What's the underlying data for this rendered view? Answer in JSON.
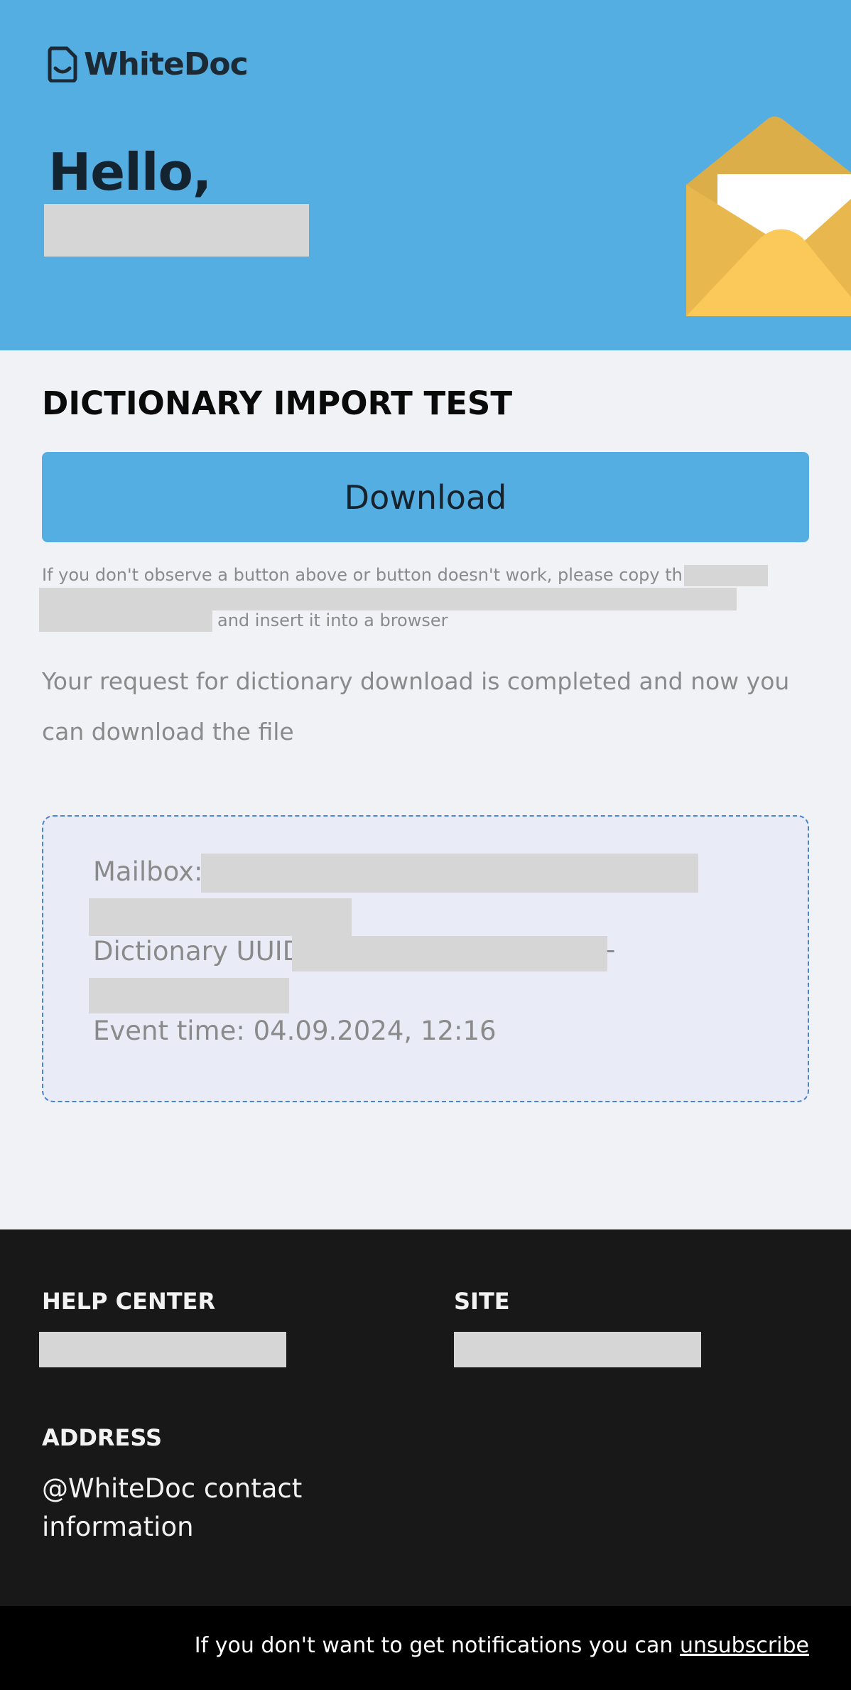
{
  "brand": {
    "name": "WhiteDoc"
  },
  "header": {
    "greeting": "Hello,"
  },
  "main": {
    "title": "DICTIONARY IMPORT TEST",
    "download_label": "Download",
    "hint_prefix": "If you don't observe a button above or button doesn't work, please copy this link",
    "hint_suffix": "and insert it into a browser",
    "description": "Your request for dictionary download is completed and now you can download the file"
  },
  "info": {
    "mailbox_label": "Mailbox:",
    "uuid_label": "Dictionary UUID:",
    "uuid_dash": "-",
    "event_time": "Event time: 04.09.2024, 12:16"
  },
  "footer": {
    "help_center": "HELP CENTER",
    "site": "SITE",
    "address": "ADDRESS",
    "address_text": "@WhiteDoc contact information"
  },
  "bottom": {
    "text": "If you don't want to get notifications you can",
    "unsubscribe": "unsubscribe"
  },
  "colors": {
    "header_bg": "#55aee2",
    "button_bg": "#55aee2",
    "footer_bg": "#181818",
    "infobox_border": "#4a84cf",
    "envelope": "#e8b84f"
  }
}
